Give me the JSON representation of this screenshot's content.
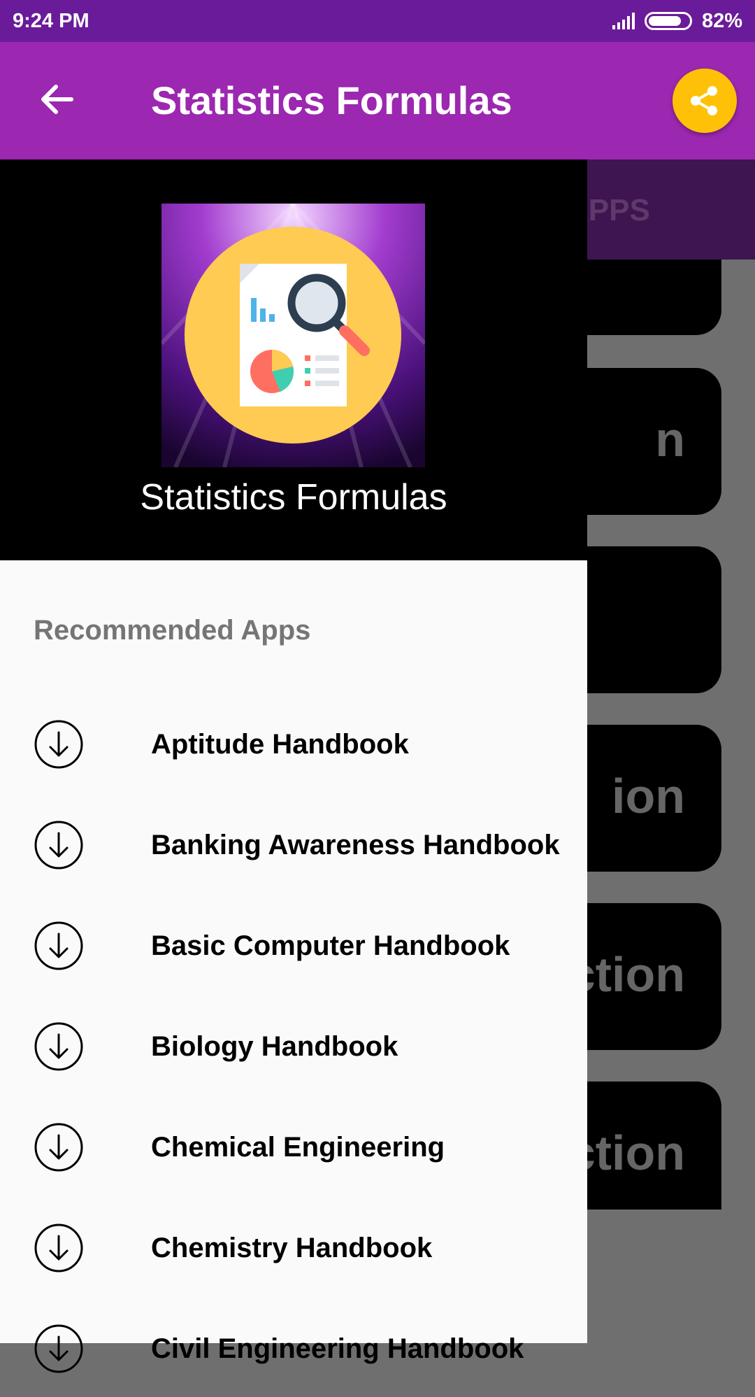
{
  "status_bar": {
    "time": "9:24 PM",
    "battery": "82%"
  },
  "app_bar": {
    "title": "Statistics Formulas",
    "back_icon": "arrow-back-icon",
    "share_icon": "share-icon",
    "share_color": "#ffc107",
    "color": "#9c27b0"
  },
  "drawer": {
    "app_name": "Statistics Formulas",
    "section_label": "Recommended Apps",
    "items": [
      {
        "label": "Aptitude Handbook",
        "icon": "download-icon"
      },
      {
        "label": "Banking Awareness Handbook",
        "icon": "download-icon"
      },
      {
        "label": "Basic Computer Handbook",
        "icon": "download-icon"
      },
      {
        "label": "Biology Handbook",
        "icon": "download-icon"
      },
      {
        "label": "Chemical Engineering",
        "icon": "download-icon"
      },
      {
        "label": "Chemistry Handbook",
        "icon": "download-icon"
      },
      {
        "label": "Civil Engineering Handbook",
        "icon": "download-icon"
      }
    ]
  },
  "background": {
    "tab_label": "APPS",
    "cards": [
      "n",
      "",
      "ion",
      "ction",
      "ction"
    ]
  }
}
